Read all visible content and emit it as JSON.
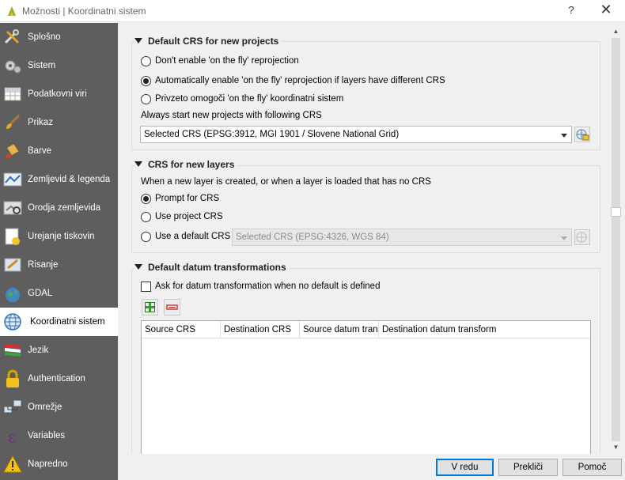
{
  "window": {
    "title": "Možnosti | Koordinatni sistem",
    "help_glyph": "?",
    "close_glyph": "✕"
  },
  "sidebar": {
    "items": [
      {
        "label": "Splošno",
        "icon": "tools-icon"
      },
      {
        "label": "Sistem",
        "icon": "gears-icon"
      },
      {
        "label": "Podatkovni viri",
        "icon": "table-icon"
      },
      {
        "label": "Prikaz",
        "icon": "brush-icon"
      },
      {
        "label": "Barve",
        "icon": "paint-icon"
      },
      {
        "label": "Zemljevid & legenda",
        "icon": "map-legend-icon"
      },
      {
        "label": "Orodja zemljevida",
        "icon": "map-tools-icon"
      },
      {
        "label": "Urejanje tiskovin",
        "icon": "layout-icon"
      },
      {
        "label": "Risanje",
        "icon": "render-icon"
      },
      {
        "label": "GDAL",
        "icon": "globe-icon"
      },
      {
        "label": "Koordinatni sistem",
        "icon": "crs-globe-icon",
        "active": true
      },
      {
        "label": "Jezik",
        "icon": "flag-icon"
      },
      {
        "label": "Authentication",
        "icon": "lock-icon"
      },
      {
        "label": "Omrežje",
        "icon": "network-icon"
      },
      {
        "label": "Variables",
        "icon": "epsilon-icon"
      },
      {
        "label": "Napredno",
        "icon": "warning-icon"
      }
    ]
  },
  "default_crs": {
    "title": "Default CRS for new projects",
    "radio_no_otf": "Don't enable 'on the fly' reprojection",
    "radio_auto_otf": "Automatically enable 'on the fly' reprojection if layers have different CRS",
    "radio_default_otf": "Privzeto omogoči 'on the fly' koordinatni sistem",
    "selected_option": "Automatically enable 'on the fly' reprojection if layers have different CRS",
    "always_start_label": "Always start new projects with following CRS",
    "crs_value": "Selected CRS (EPSG:3912, MGI 1901 / Slovene National Grid)"
  },
  "layer_crs": {
    "title": "CRS for new layers",
    "description": "When a new layer is created, or when a layer is loaded that has no CRS",
    "radio_prompt": "Prompt for CRS",
    "radio_project": "Use project CRS",
    "radio_default": "Use a default CRS",
    "selected_option": "Prompt for CRS",
    "default_crs_value": "Selected CRS (EPSG:4326, WGS 84)"
  },
  "datum": {
    "title": "Default datum transformations",
    "ask_checkbox_label": "Ask for datum transformation when no default is defined",
    "ask_checked": false,
    "columns": [
      "Source CRS",
      "Destination CRS",
      "Source datum trans",
      "Destination datum transform"
    ]
  },
  "footer": {
    "ok_label": "V redu",
    "cancel_label": "Prekliči",
    "help_label": "Pomoč"
  },
  "colors": {
    "sidebar_bg": "#5e5e5e",
    "accent": "#0078d7"
  }
}
